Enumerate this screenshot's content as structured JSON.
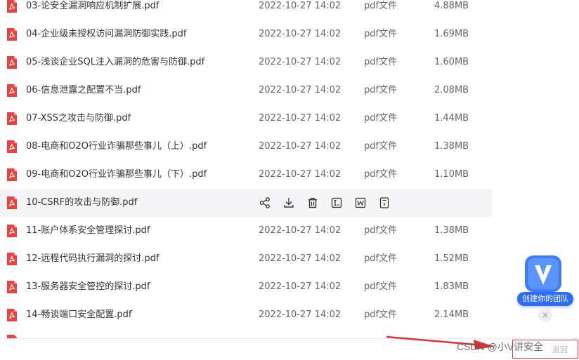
{
  "files": [
    {
      "name": "03-论安全漏洞响应机制扩展.pdf",
      "date": "2022-10-27 14:02",
      "type": "pdf文件",
      "size": "4.88MB"
    },
    {
      "name": "04-企业级未授权访问漏洞防御实践.pdf",
      "date": "2022-10-27 14:02",
      "type": "pdf文件",
      "size": "1.69MB"
    },
    {
      "name": "05-浅谈企业SQL注入漏洞的危害与防御.pdf",
      "date": "2022-10-27 14:02",
      "type": "pdf文件",
      "size": "1.60MB"
    },
    {
      "name": "06-信息泄露之配置不当.pdf",
      "date": "2022-10-27 14:02",
      "type": "pdf文件",
      "size": "2.08MB"
    },
    {
      "name": "07-XSS之攻击与防御.pdf",
      "date": "2022-10-27 14:02",
      "type": "pdf文件",
      "size": "1.44MB"
    },
    {
      "name": "08-电商和O2O行业诈骗那些事儿（上）.pdf",
      "date": "2022-10-27 14:02",
      "type": "pdf文件",
      "size": "1.38MB"
    },
    {
      "name": "09-电商和O2O行业诈骗那些事儿（下）.pdf",
      "date": "2022-10-27 14:02",
      "type": "pdf文件",
      "size": "1.10MB"
    },
    {
      "name": "10-CSRF的攻击与防御.pdf",
      "hover": true
    },
    {
      "name": "11-账户体系安全管理探讨.pdf",
      "date": "2022-10-27 14:02",
      "type": "pdf文件",
      "size": "1.38MB"
    },
    {
      "name": "12-远程代码执行漏洞的探讨.pdf",
      "date": "2022-10-27 14:02",
      "type": "pdf文件",
      "size": "1.52MB"
    },
    {
      "name": "13-服务器安全管控的探讨.pdf",
      "date": "2022-10-27 14:02",
      "type": "pdf文件",
      "size": "1.83MB"
    },
    {
      "name": "14-畅谈端口安全配置.pdf",
      "date": "2022-10-27 14:02",
      "type": "pdf文件",
      "size": "2.14MB"
    }
  ],
  "hover_actions": [
    "share-icon",
    "download-icon",
    "delete-icon",
    "rename-icon",
    "word-convert-icon",
    "file-info-icon"
  ],
  "team_widget": {
    "label": "创建你的团队",
    "close": "×"
  },
  "watermark": "CSDN @小V讲安全",
  "redbox_text": "返回",
  "colors": {
    "pdf_red": "#e8433f",
    "accent": "#2d6df6",
    "row_hover": "#f5f5f7",
    "annotation_red": "#e04040"
  }
}
